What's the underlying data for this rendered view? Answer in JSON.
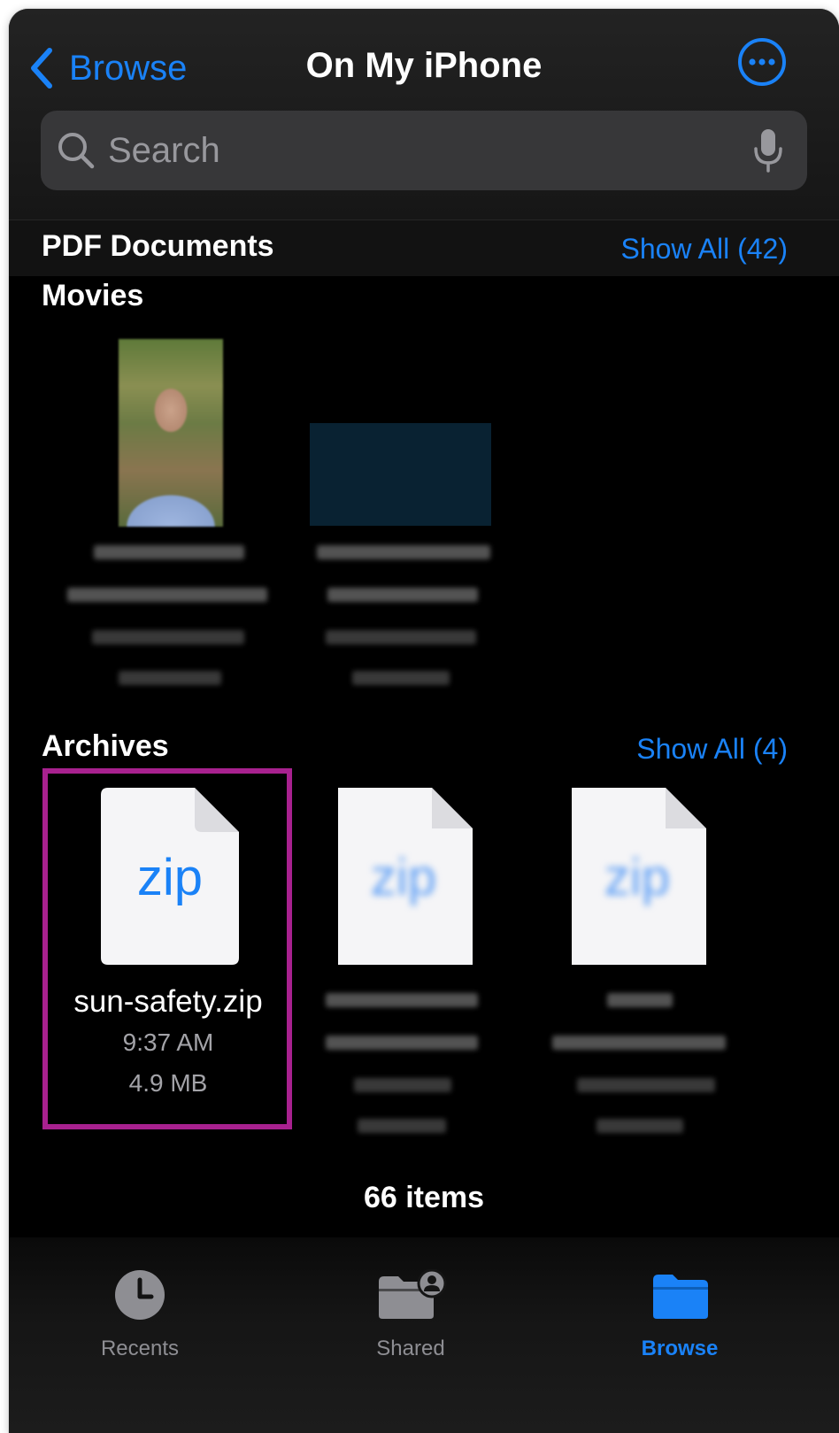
{
  "nav": {
    "back_label": "Browse",
    "title": "On My iPhone"
  },
  "search": {
    "placeholder": "Search"
  },
  "sections": {
    "pdf": {
      "title": "PDF Documents",
      "show_all": "Show All (42)"
    },
    "movies": {
      "title": "Movies"
    },
    "archives": {
      "title": "Archives",
      "show_all": "Show All (4)"
    }
  },
  "archives": {
    "selected": {
      "icon_label": "zip",
      "name": "sun-safety.zip",
      "time": "9:37 AM",
      "size": "4.9 MB"
    }
  },
  "footer": {
    "item_count": "66 items"
  },
  "tabbar": {
    "recents": "Recents",
    "shared": "Shared",
    "browse": "Browse"
  },
  "colors": {
    "accent": "#1a82f7",
    "highlight_border": "#a8218f",
    "background": "#000000"
  }
}
